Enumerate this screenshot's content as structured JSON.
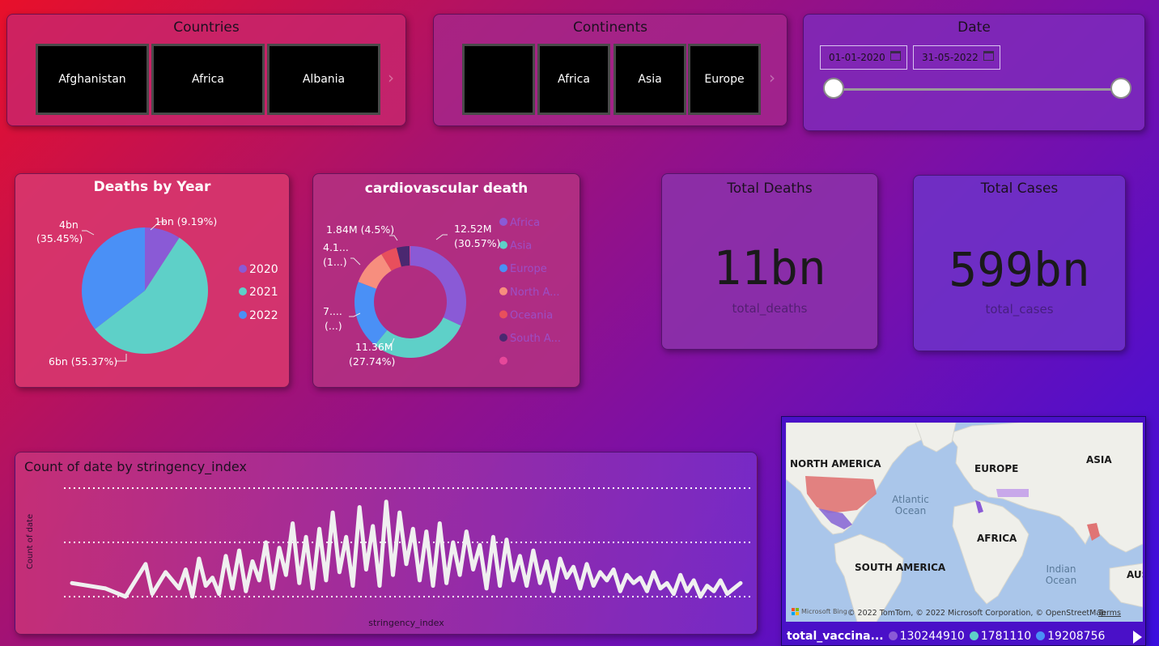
{
  "slicers": {
    "countries": {
      "title": "Countries",
      "items": [
        "Afghanistan",
        "Africa",
        "Albania"
      ]
    },
    "continents": {
      "title": "Continents",
      "items": [
        "",
        "Africa",
        "Asia",
        "Europe"
      ]
    },
    "date": {
      "title": "Date",
      "start": "01-01-2020",
      "end": "31-05-2022",
      "range_start_fraction": 0,
      "range_end_fraction": 1
    }
  },
  "deaths_by_year": {
    "title": "Deaths by Year",
    "legend": [
      "2020",
      "2021",
      "2022"
    ],
    "labels": {
      "2020": "1bn (9.19%)",
      "2021": "6bn (55.37%)",
      "2022_line1": "4bn",
      "2022_line2": "(35.45%)"
    },
    "colors": {
      "2020": "#8a5ad6",
      "2021": "#5ed0c8",
      "2022": "#4a90f6"
    }
  },
  "cardiovascular": {
    "title": "cardiovascular death",
    "legend": [
      "Africa",
      "Asia",
      "Europe",
      "North A...",
      "Oceania",
      "South A...",
      ""
    ],
    "labels": {
      "africa_l1": "12.52M",
      "africa_l2": "(30.57%)",
      "asia_l1": "11.36M",
      "asia_l2": "(27.74%)",
      "europe_l1": "7....",
      "europe_l2": "(...)",
      "na_l1": "4.1...",
      "na_l2": "(1...)",
      "oceania": "1.84M (4.5%)"
    }
  },
  "kpis": {
    "total_deaths": {
      "title": "Total Deaths",
      "value": "11bn",
      "sub": "total_deaths"
    },
    "total_cases": {
      "title": "Total Cases",
      "value": "599bn",
      "sub": "total_cases"
    }
  },
  "line_chart": {
    "title": "Count of date by stringency_index",
    "xlabel": "stringency_index",
    "ylabel": "Count of date"
  },
  "map": {
    "regions": {
      "na": "NORTH AMERICA",
      "eu": "EUROPE",
      "asia": "ASIA",
      "atl1": "Atlantic",
      "atl2": "Ocean",
      "africa": "AFRICA",
      "sa": "SOUTH AMERICA",
      "ind1": "Indian",
      "ind2": "Ocean",
      "aus": "AUST"
    },
    "attribution": "© 2022 TomTom, © 2022 Microsoft Corporation, © OpenStreetMap",
    "terms": "Terms",
    "brand": "Microsoft Bing",
    "legend_title": "total_vaccina...",
    "legend_values": [
      "130244910",
      "1781110",
      "19208756"
    ],
    "legend_colors": [
      "#8a5ad6",
      "#5ed0c8",
      "#4a90f6"
    ]
  },
  "chart_data": [
    {
      "type": "pie",
      "title": "Deaths by Year",
      "categories": [
        "2020",
        "2021",
        "2022"
      ],
      "values": [
        1,
        6,
        4
      ],
      "percent": [
        9.19,
        55.37,
        35.45
      ]
    },
    {
      "type": "pie",
      "title": "cardiovascular death",
      "categories": [
        "Africa",
        "Asia",
        "Europe",
        "North A...",
        "Oceania",
        "South A...",
        ""
      ],
      "values": [
        12.52,
        11.36,
        null,
        4.1,
        1.84,
        null,
        null
      ],
      "percent": [
        30.57,
        27.74,
        null,
        null,
        4.5,
        null,
        null
      ],
      "colors": [
        "#8a5ad6",
        "#5ed0c8",
        "#4a90f6",
        "#f78e7e",
        "#e84f5c",
        "#4a2870",
        "#e6479a"
      ],
      "approx_percent_for_drawing": [
        30.57,
        27.74,
        19.0,
        10.0,
        4.5,
        3.6,
        0.2
      ]
    },
    {
      "type": "line",
      "title": "Count of date by stringency_index",
      "xlabel": "stringency_index",
      "ylabel": "Count of date",
      "xlim": [
        0,
        100
      ],
      "ylim": [
        0,
        40
      ],
      "x": [
        0,
        5,
        8,
        11,
        12,
        14,
        16,
        17,
        18,
        19,
        20,
        21,
        22,
        23,
        24,
        25,
        26,
        27,
        28,
        29,
        30,
        31,
        32,
        33,
        34,
        35,
        36,
        37,
        38,
        39,
        40,
        41,
        42,
        43,
        44,
        45,
        46,
        47,
        48,
        49,
        50,
        51,
        52,
        53,
        54,
        55,
        56,
        57,
        58,
        59,
        60,
        61,
        62,
        63,
        64,
        65,
        66,
        67,
        68,
        69,
        70,
        71,
        72,
        73,
        74,
        75,
        76,
        77,
        78,
        79,
        80,
        81,
        82,
        83,
        84,
        85,
        86,
        87,
        88,
        89,
        90,
        91,
        92,
        93,
        94,
        95,
        96,
        97,
        98,
        99,
        100
      ],
      "y": [
        5,
        3,
        0,
        12,
        1,
        9,
        3,
        10,
        0,
        14,
        4,
        7,
        1,
        15,
        3,
        17,
        2,
        13,
        6,
        20,
        3,
        18,
        8,
        27,
        5,
        22,
        3,
        25,
        6,
        31,
        9,
        22,
        4,
        33,
        10,
        26,
        4,
        35,
        8,
        31,
        12,
        25,
        6,
        24,
        4,
        27,
        5,
        20,
        8,
        24,
        10,
        19,
        3,
        22,
        4,
        21,
        6,
        15,
        4,
        17,
        5,
        13,
        2,
        14,
        7,
        11,
        3,
        12,
        4,
        9,
        6,
        10,
        2,
        8,
        5,
        7,
        2,
        9,
        3,
        5,
        1,
        8,
        2,
        6,
        0,
        4,
        2,
        6,
        1,
        3,
        5
      ],
      "grid": true,
      "series_color": "#f0f0f0"
    }
  ]
}
